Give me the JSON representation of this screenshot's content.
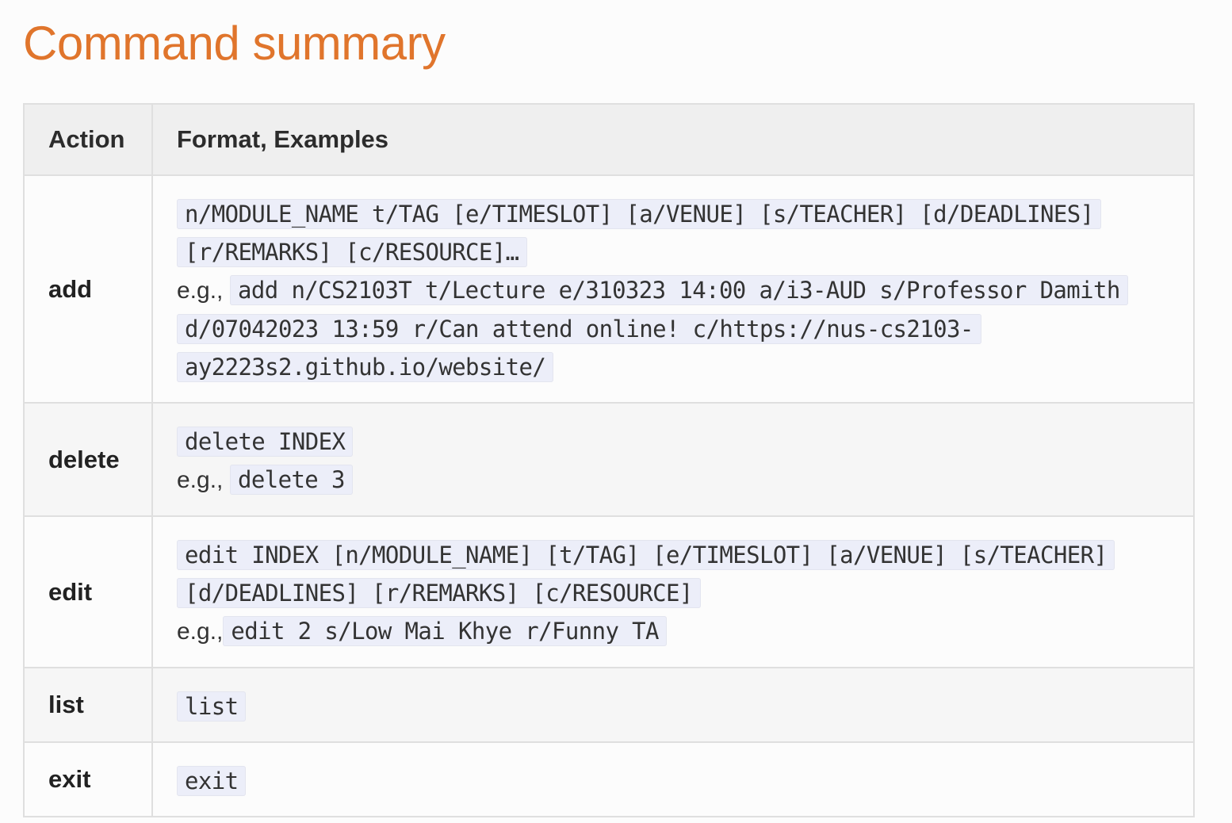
{
  "page": {
    "title": "Command summary"
  },
  "table": {
    "headers": {
      "action": "Action",
      "format": "Format, Examples"
    },
    "rows": [
      {
        "action": "add",
        "format": "n/MODULE_NAME t/TAG [e/TIMESLOT] [a/VENUE] [s/TEACHER] [d/DEADLINES] [r/REMARKS] [c/RESOURCE]…",
        "example_prefix": "e.g.,",
        "example": "add n/CS2103T t/Lecture e/310323 14:00 a/i3-AUD s/Professor Damith d/07042023 13:59 r/Can attend online! c/https://nus-cs2103-ay2223s2.github.io/website/"
      },
      {
        "action": "delete",
        "format": "delete INDEX",
        "example_prefix": "e.g.,",
        "example": "delete 3"
      },
      {
        "action": "edit",
        "format": "edit INDEX [n/MODULE_NAME] [t/TAG] [e/TIMESLOT] [a/VENUE] [s/TEACHER] [d/DEADLINES] [r/REMARKS] [c/RESOURCE]",
        "example_prefix": "e.g.,",
        "example": "edit 2 s/Low Mai Khye r/Funny TA"
      },
      {
        "action": "list",
        "format": "list"
      },
      {
        "action": "exit",
        "format": "exit"
      }
    ]
  },
  "colors": {
    "title": "#e0752c",
    "code_background": "#eceef9",
    "header_background": "#efefef",
    "border": "#dfdfdf"
  }
}
